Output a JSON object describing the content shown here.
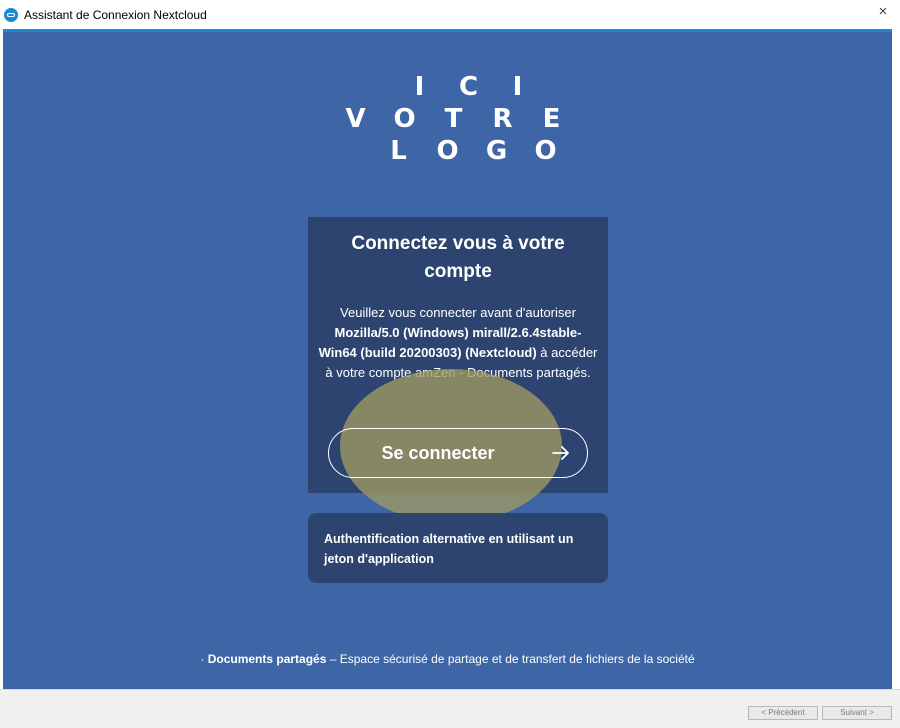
{
  "window": {
    "title": "Assistant de Connexion Nextcloud",
    "close_glyph": "×"
  },
  "logo": {
    "line1": [
      "I",
      "C",
      "I"
    ],
    "line2": [
      "V",
      "O",
      "T",
      "R",
      "E"
    ],
    "line3": [
      "L",
      "O",
      "G",
      "O"
    ]
  },
  "login": {
    "title": "Connectez vous à votre compte",
    "desc_prefix": "Veuillez vous connecter avant d'autoriser",
    "desc_client": "Mozilla/5.0 (Windows) mirall/2.6.4stable-Win64 (build 20200303) (Nextcloud)",
    "desc_suffix": "à accéder à votre compte amZen - Documents partagés.",
    "button_label": "Se connecter"
  },
  "alt_auth": {
    "label": "Authentification alternative en utilisant un jeton d'application"
  },
  "footer": {
    "bullet": "·",
    "name": "Documents partagés",
    "text": "– Espace sécurisé de partage et de transfert de fichiers de la société"
  },
  "nav": {
    "prev_label": "< Précédent",
    "next_label": "Suivant >"
  },
  "colors": {
    "background": "#3e66a6",
    "card": "#2e4470",
    "accent": "#1e88d0"
  }
}
